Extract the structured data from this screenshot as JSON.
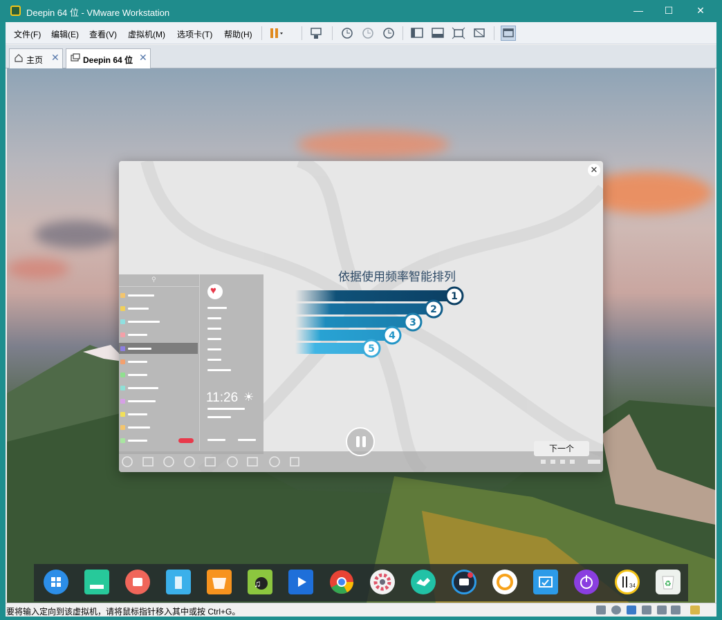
{
  "window": {
    "title": "Deepin 64 位 - VMware Workstation"
  },
  "menu": {
    "file": "文件(F)",
    "edit": "编辑(E)",
    "view": "查看(V)",
    "vm": "虚拟机(M)",
    "tabs": "选项卡(T)",
    "help": "帮助(H)"
  },
  "tabs": [
    {
      "label": "主页"
    },
    {
      "label": "Deepin 64 位"
    }
  ],
  "guest": {
    "overlay": {
      "heading": "依据使用频率智能排列",
      "ranks": [
        "1",
        "2",
        "3",
        "4",
        "5"
      ],
      "next_label": "下一个",
      "launcher_clock": "11:26"
    },
    "dock_icons": [
      "launcher-icon",
      "multitask-icon",
      "screen-recorder-icon",
      "file-manager-icon",
      "app-store-icon",
      "music-icon",
      "movie-icon",
      "chrome-icon",
      "settings-icon",
      "remote-help-icon",
      "input-method-icon",
      "sync-icon",
      "screenshot-icon",
      "power-icon",
      "clock-icon",
      "trash-icon"
    ]
  },
  "statusbar": {
    "message": "要将输入定向到该虚拟机，请将鼠标指针移入其中或按 Ctrl+G。"
  }
}
